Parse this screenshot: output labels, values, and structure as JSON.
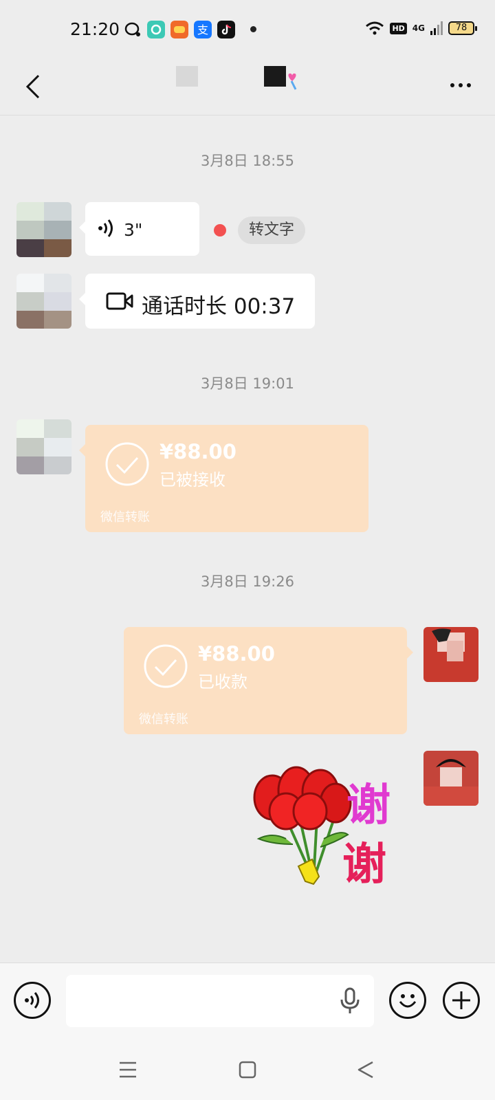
{
  "status_bar": {
    "time": "21:20",
    "apps": [
      "qq-icon",
      "messages-icon",
      "game-center-icon",
      "alipay-icon",
      "tiktok-icon"
    ],
    "network": "4G",
    "hd": "HD",
    "battery": "78"
  },
  "header": {
    "back_icon": "chevron-left-icon",
    "more_icon": "more-dots-icon"
  },
  "messages": {
    "ts1": "3月8日 18:55",
    "voice_length": "3\"",
    "to_text_label": "转文字",
    "call_text": "通话时长 00:37",
    "ts2": "3月8日 19:01",
    "transfer1": {
      "amount": "¥88.00",
      "status": "已被接收",
      "label": "微信转账"
    },
    "ts3": "3月8日 19:26",
    "transfer2": {
      "amount": "¥88.00",
      "status": "已收款",
      "label": "微信转账"
    },
    "sticker_text1": "谢",
    "sticker_text2": "谢"
  },
  "input_bar": {
    "voice_icon": "voice-mode-icon",
    "mic_icon": "microphone-icon",
    "emoji_icon": "emoji-icon",
    "plus_icon": "plus-icon"
  },
  "colors": {
    "background": "#ededed",
    "transfer": "#fce0c3",
    "unread": "#f35151",
    "sticker_pink": "#e03ad0",
    "sticker_red": "#e5205a"
  }
}
